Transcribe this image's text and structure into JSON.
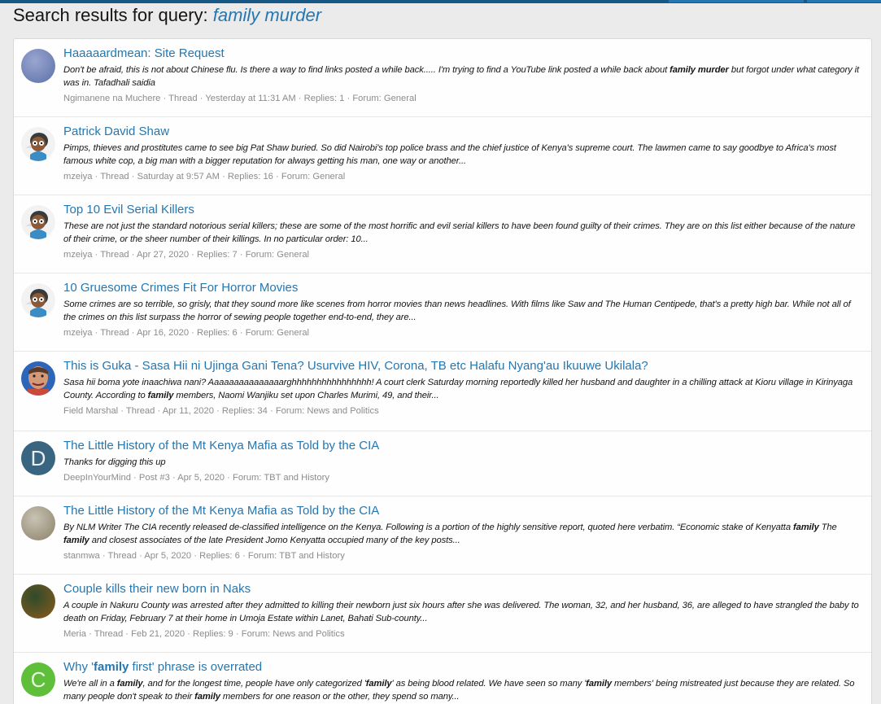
{
  "header": {
    "prefix": "Search results for query:",
    "query": "family murder"
  },
  "results": [
    {
      "title": "Haaaaardmean: Site Request",
      "snippet": "Don't be afraid, this is not about Chinese flu. Is there a way to find links posted a while back..... I'm trying to find a YouTube link posted a while back about <b>family</b> <b>murder</b> but forgot under what category it was in. Tafadhali saidia",
      "author": "Ngimanene na Muchere",
      "type": "Thread",
      "date": "Yesterday at 11:31 AM",
      "replies": "Replies: 1",
      "forum": "Forum: General",
      "avatar": {
        "kind": "photo",
        "colors": [
          "#5b6fa8",
          "#9aa6d0"
        ]
      }
    },
    {
      "title": "Patrick David Shaw",
      "snippet": "Pimps, thieves and prostitutes came to see big Pat Shaw buried. So did Nairobi's top police brass and the chief justice of Kenya's supreme court. The lawmen came to say goodbye to Africa's most famous white cop, a big man with a bigger reputation for always getting his man, one way or another...",
      "author": "mzeiya",
      "type": "Thread",
      "date": "Saturday at 9:57 AM",
      "replies": "Replies: 16",
      "forum": "Forum: General",
      "avatar": {
        "kind": "cartoon"
      }
    },
    {
      "title": "Top 10 Evil Serial Killers",
      "snippet": "These are not just the standard notorious serial killers; these are some of the most horrific and evil serial killers to have been found guilty of their crimes. They are on this list either because of the nature of their crime, or the sheer number of their killings. In no particular order: 10...",
      "author": "mzeiya",
      "type": "Thread",
      "date": "Apr 27, 2020",
      "replies": "Replies: 7",
      "forum": "Forum: General",
      "avatar": {
        "kind": "cartoon"
      }
    },
    {
      "title": "10 Gruesome Crimes Fit For Horror Movies",
      "snippet": "Some crimes are so terrible, so grisly, that they sound more like scenes from horror movies than news headlines. With films like Saw and The Human Centipede, that's a pretty high bar. While not all of the crimes on this list surpass the horror of sewing people together end-to-end, they are...",
      "author": "mzeiya",
      "type": "Thread",
      "date": "Apr 16, 2020",
      "replies": "Replies: 6",
      "forum": "Forum: General",
      "avatar": {
        "kind": "cartoon"
      }
    },
    {
      "title": "This is Guka - Sasa Hii ni Ujinga Gani Tena? Usurvive HIV, Corona, TB etc Halafu Nyang'au Ikuuwe Ukilala?",
      "snippet": "Sasa hii boma yote inaachiwa nani? Aaaaaaaaaaaaaaarghhhhhhhhhhhhhhhh! A court clerk Saturday morning reportedly killed her husband and daughter in a chilling attack at Kioru village in Kirinyaga County. According to <b>family</b> members, Naomi Wanjiku set upon Charles Murimi, 49, and their...",
      "author": "Field Marshal",
      "type": "Thread",
      "date": "Apr 11, 2020",
      "replies": "Replies: 34",
      "forum": "Forum: News and Politics",
      "avatar": {
        "kind": "face"
      }
    },
    {
      "title": "The Little History of the Mt Kenya Mafia as Told by the CIA",
      "snippet": "Thanks for digging this up",
      "author": "DeepInYourMind",
      "type": "Post #3",
      "date": "Apr 5, 2020",
      "replies": "",
      "forum": "Forum: TBT and History",
      "avatar": {
        "kind": "letter",
        "letter": "D",
        "bg": "#3a6580",
        "fg": "#e9eef2"
      }
    },
    {
      "title": "The Little History of the Mt Kenya Mafia as Told by the CIA",
      "snippet": "By NLM Writer The CIA recently released de-classified intelligence on the Kenya. Following is a portion of the highly sensitive report, quoted here verbatim. “Economic stake of Kenyatta <b>family</b> The <b>family</b> and closest associates of the late President Jomo Kenyatta occupied many of the key posts...",
      "author": "stanmwa",
      "type": "Thread",
      "date": "Apr 5, 2020",
      "replies": "Replies: 6",
      "forum": "Forum: TBT and History",
      "avatar": {
        "kind": "photo",
        "colors": [
          "#8a8068",
          "#c9c3b4"
        ]
      }
    },
    {
      "title": "Couple kills their new born in Naks",
      "snippet": "A couple in Nakuru County was arrested after they admitted to killing their newborn just six hours after she was delivered. The woman, 32, and her husband, 36, are alleged to have strangled the baby to death on Friday, February 7 at their home in Umoja Estate within Lanet, Bahati Sub-county...",
      "author": "Meria",
      "type": "Thread",
      "date": "Feb 21, 2020",
      "replies": "Replies: 9",
      "forum": "Forum: News and Politics",
      "avatar": {
        "kind": "photo",
        "colors": [
          "#8a5b1e",
          "#2f4a2a"
        ]
      }
    },
    {
      "title": "Why '<b>family</b> first' phrase is overrated",
      "snippet": "We're all in a <b>family</b>, and for the longest time, people have only categorized '<b>family</b>' as being blood related. We have seen so many '<b>family</b> members' being mistreated just because they are related. So many people don't speak to their <b>family</b> members for one reason or the other, they spend so many...",
      "author": "",
      "type": "",
      "date": "",
      "replies": "",
      "forum": "",
      "avatar": {
        "kind": "letter",
        "letter": "C",
        "bg": "#5fbf3a",
        "fg": "#eaf7e3"
      }
    }
  ]
}
